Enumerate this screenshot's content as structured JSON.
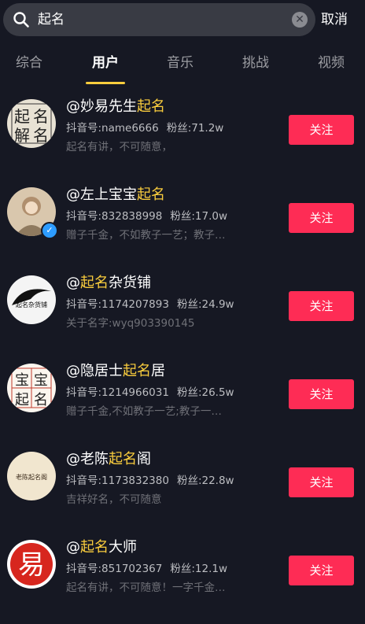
{
  "search": {
    "query": "起名",
    "cancel_label": "取消"
  },
  "tabs": [
    {
      "label": "综合",
      "active": false
    },
    {
      "label": "用户",
      "active": true
    },
    {
      "label": "音乐",
      "active": false
    },
    {
      "label": "挑战",
      "active": false
    },
    {
      "label": "视频",
      "active": false
    }
  ],
  "colors": {
    "background": "#161823",
    "highlight": "#facd3d",
    "follow_button": "#fe2c55",
    "tab_indicator": "#facd3d"
  },
  "users": [
    {
      "name_prefix": "@妙易先生",
      "name_hl": "起名",
      "name_suffix": "",
      "douyin_id": "抖音号:name6666",
      "fans": "粉丝:71.2w",
      "signature": "起名有讲，不可随意，",
      "follow_label": "关注",
      "avatar_text": [
        "起",
        "名",
        "解",
        "名"
      ],
      "verified": false
    },
    {
      "name_prefix": "@左上宝宝",
      "name_hl": "起名",
      "name_suffix": "",
      "douyin_id": "抖音号:832838998",
      "fans": "粉丝:17.0w",
      "signature": "赠子千金，不如教子一艺；教子…",
      "follow_label": "关注",
      "verified": true
    },
    {
      "name_prefix": "@",
      "name_hl": "起名",
      "name_suffix": "杂货铺",
      "douyin_id": "抖音号:1174207893",
      "fans": "粉丝:24.9w",
      "signature": "关于名字:wyq903390145",
      "follow_label": "关注",
      "avatar_text": [
        "起名杂货铺"
      ],
      "verified": false
    },
    {
      "name_prefix": "@隐居士",
      "name_hl": "起名",
      "name_suffix": "居",
      "douyin_id": "抖音号:1214966031",
      "fans": "粉丝:26.5w",
      "signature": "赠子千金,不如教子一艺;教子一…",
      "follow_label": "关注",
      "avatar_text": [
        "宝",
        "宝",
        "起",
        "名"
      ],
      "verified": false
    },
    {
      "name_prefix": "@老陈",
      "name_hl": "起名",
      "name_suffix": "阁",
      "douyin_id": "抖音号:1173832380",
      "fans": "粉丝:22.8w",
      "signature": "吉祥好名，不可随意",
      "follow_label": "关注",
      "avatar_text": [
        "老陈起名阁"
      ],
      "verified": false
    },
    {
      "name_prefix": "@",
      "name_hl": "起名",
      "name_suffix": "大师",
      "douyin_id": "抖音号:851702367",
      "fans": "粉丝:12.1w",
      "signature": "起名有讲，不可随意！一字千金…",
      "follow_label": "关注",
      "avatar_text": [
        "易"
      ],
      "verified": false
    }
  ]
}
